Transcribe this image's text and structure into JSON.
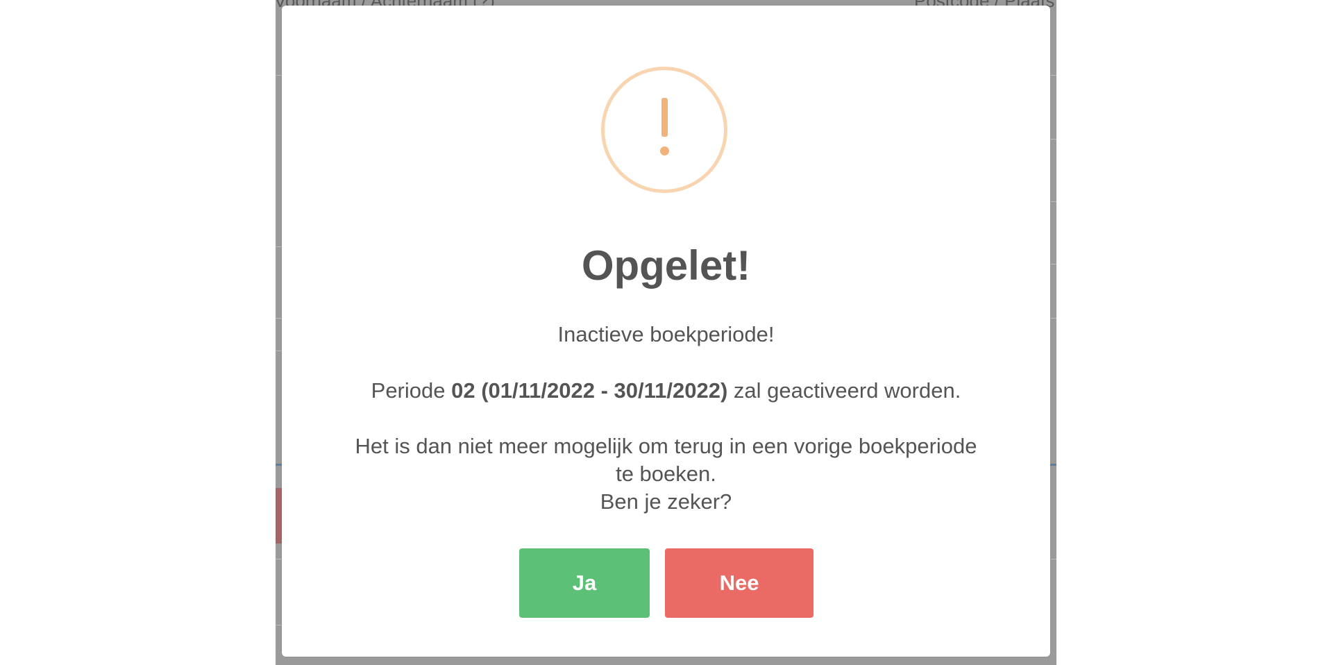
{
  "background": {
    "header_left": "Voornaam / Achternaam (?)",
    "header_right": "Postcode / Plaats"
  },
  "dialog": {
    "icon": "exclamation-warning-icon",
    "title": "Opgelet!",
    "line1": "Inactieve boekperiode!",
    "line2_prefix": "Periode",
    "line2_bold": "02 (01/11/2022 - 30/11/2022)",
    "line2_suffix": "zal geactiveerd worden.",
    "line3a": "Het is dan niet meer mogelijk om terug in een vorige boekperiode",
    "line3b": "te boeken.",
    "line4": "Ben je zeker?",
    "confirm_label": "Ja",
    "cancel_label": "Nee"
  },
  "colors": {
    "confirm": "#5cc077",
    "cancel": "#ea6b66",
    "warning_icon": "#f1b27b",
    "overlay": "#9a9a9a"
  }
}
